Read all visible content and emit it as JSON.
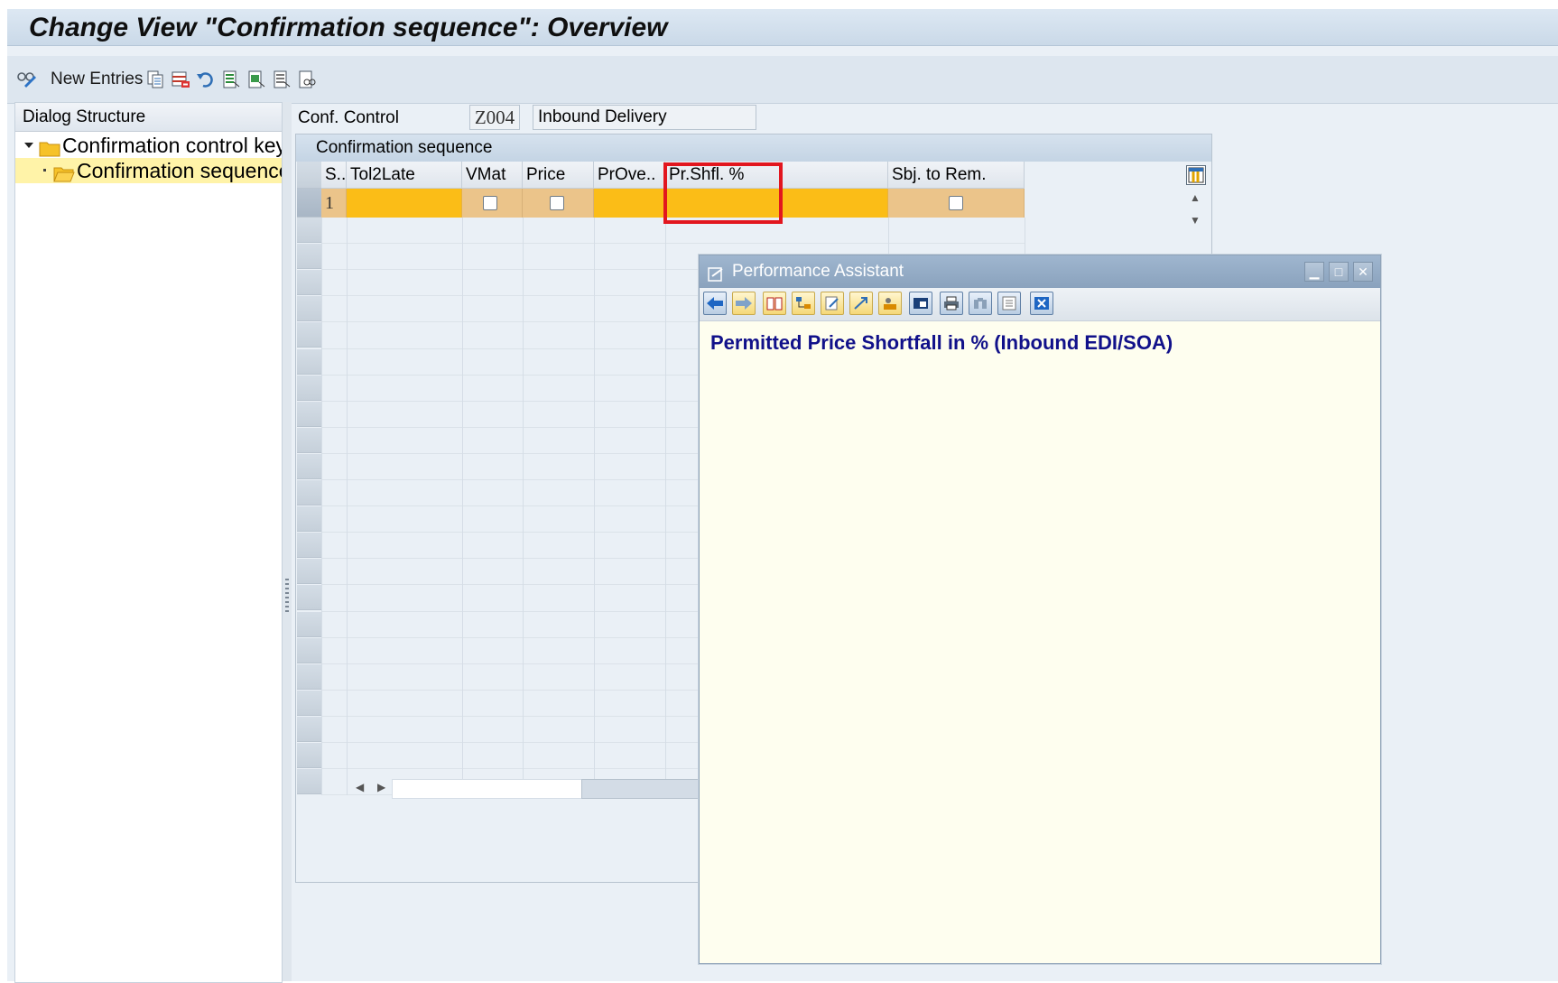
{
  "window": {
    "title": "Change View \"Confirmation sequence\": Overview"
  },
  "toolbar": {
    "new_entries_label": "New Entries"
  },
  "dialog_structure": {
    "header": "Dialog Structure",
    "items": [
      {
        "label": "Confirmation control key",
        "level": 0,
        "expanded": true,
        "selected": false
      },
      {
        "label": "Confirmation sequence",
        "level": 1,
        "expanded": false,
        "selected": true
      }
    ]
  },
  "conf_control": {
    "label": "Conf. Control",
    "key": "Z004",
    "description": "Inbound Delivery"
  },
  "table": {
    "title": "Confirmation sequence",
    "columns": [
      {
        "label": "S.."
      },
      {
        "label": "Tol2Late"
      },
      {
        "label": "VMat"
      },
      {
        "label": "Price"
      },
      {
        "label": "PrOve.."
      },
      {
        "label": "Pr.Shfl. %"
      },
      {
        "label": "Sbj. to Rem."
      }
    ],
    "rows": [
      {
        "seq": "1",
        "tol2late": "",
        "vmat": false,
        "price": false,
        "prove": "",
        "prshfl": "",
        "sbj_to_rem": false
      }
    ],
    "highlighted_column": "Pr.Shfl. %"
  },
  "performance_assistant": {
    "title": "Performance Assistant",
    "heading": "Permitted Price Shortfall in % (Inbound EDI/SOA)"
  },
  "colors": {
    "selected_row": "#fbbd17",
    "highlight_box": "#e2161e",
    "pa_heading": "#11118a",
    "pa_background": "#fefeef"
  }
}
